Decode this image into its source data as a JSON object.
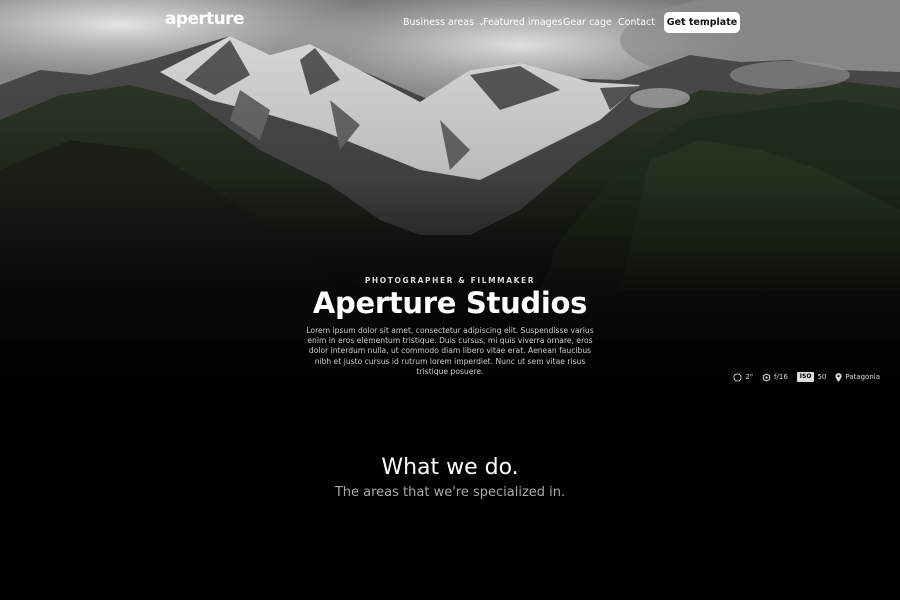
{
  "nav": {
    "logo": "aperture",
    "links": [
      {
        "label": "Business areas",
        "has_dropdown": true
      },
      {
        "label": "Featured images"
      },
      {
        "label": "Gear cage"
      },
      {
        "label": "Contact"
      }
    ],
    "cta_label": "Get template"
  },
  "hero": {
    "eyebrow": "PHOTOGRAPHER & FILMMAKER",
    "title": "Aperture Studios",
    "description": "Lorem ipsum dolor sit amet, consectetur adipiscing elit. Suspendisse varius enim in eros elementum tristique. Duis cursus, mi quis viverra ornare, eros dolor interdum nulla, ut commodo diam libero vitae erat. Aenean faucibus nibh et justo cursus id rutrum lorem imperdiet. Nunc ut sem vitae risus tristique posuere.",
    "meta": {
      "shutter": "2\"",
      "aperture": "f/16",
      "iso_label": "ISO",
      "iso_value": "50",
      "location": "Patagonia"
    }
  },
  "section": {
    "title": "What we do.",
    "subtitle": "The areas that we're specialized in."
  },
  "colors": {
    "background": "#000000",
    "cta_background": "#ffffff",
    "subtitle": "#a9a9a9"
  }
}
